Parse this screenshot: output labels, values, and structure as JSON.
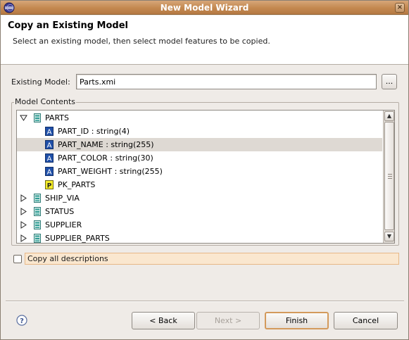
{
  "window": {
    "title": "New Model Wizard",
    "close_glyph": "×",
    "app_icon": "eclipse-icon"
  },
  "header": {
    "title": "Copy an Existing Model",
    "description": "Select an existing model, then select model features to be copied."
  },
  "existing_model": {
    "label": "Existing Model:",
    "value": "Parts.xmi",
    "browse_label": "..."
  },
  "model_contents": {
    "group_label": "Model Contents",
    "rows": [
      {
        "label": "PARTS",
        "icon": "table-icon",
        "expanded": true,
        "depth": 0
      },
      {
        "label": "PART_ID : string(4)",
        "icon": "attribute-icon",
        "depth": 1
      },
      {
        "label": "PART_NAME : string(255)",
        "icon": "attribute-icon",
        "depth": 1,
        "selected": true
      },
      {
        "label": "PART_COLOR : string(30)",
        "icon": "attribute-icon",
        "depth": 1
      },
      {
        "label": "PART_WEIGHT : string(255)",
        "icon": "attribute-icon",
        "depth": 1
      },
      {
        "label": "PK_PARTS",
        "icon": "primary-key-icon",
        "depth": 1
      },
      {
        "label": "SHIP_VIA",
        "icon": "table-icon",
        "expanded": false,
        "depth": 0
      },
      {
        "label": "STATUS",
        "icon": "table-icon",
        "expanded": false,
        "depth": 0
      },
      {
        "label": "SUPPLIER",
        "icon": "table-icon",
        "expanded": false,
        "depth": 0
      },
      {
        "label": "SUPPLIER_PARTS",
        "icon": "table-icon",
        "expanded": false,
        "depth": 0
      }
    ]
  },
  "copy_descriptions": {
    "label": "Copy all descriptions",
    "checked": false
  },
  "buttons": {
    "back": "< Back",
    "next": "Next >",
    "finish": "Finish",
    "cancel": "Cancel"
  },
  "colors": {
    "titlebar": "#c3884f",
    "selection": "#ded9d3",
    "focus_highlight": "#fae7cf",
    "default_button_border": "#d39a5c"
  }
}
